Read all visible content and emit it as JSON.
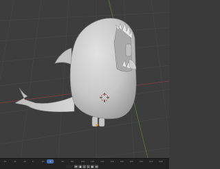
{
  "timeline": {
    "current_frame": "1",
    "ruler_labels": [
      "-60",
      "-40",
      "-20",
      "0",
      "20",
      "40",
      "60",
      "80",
      "100",
      "120",
      "140",
      "160",
      "180",
      "200",
      "220",
      "240",
      "260"
    ]
  },
  "playback": {
    "buttons": [
      {
        "name": "jump-start-icon",
        "glyph": "⏮"
      },
      {
        "name": "prev-keyframe-icon",
        "glyph": "◀"
      },
      {
        "name": "play-reverse-icon",
        "glyph": "◁"
      },
      {
        "name": "play-icon",
        "glyph": "▷"
      },
      {
        "name": "next-keyframe-icon",
        "glyph": "▶"
      },
      {
        "name": "jump-end-icon",
        "glyph": "⏭"
      }
    ]
  },
  "colors": {
    "viewport_bg": "#3d3d3d",
    "grid_line": "#474747",
    "axis_red": "#8e3b3b",
    "axis_green": "#5e7a2c",
    "model": "#d0d0d0",
    "accent": "#4772b3"
  }
}
